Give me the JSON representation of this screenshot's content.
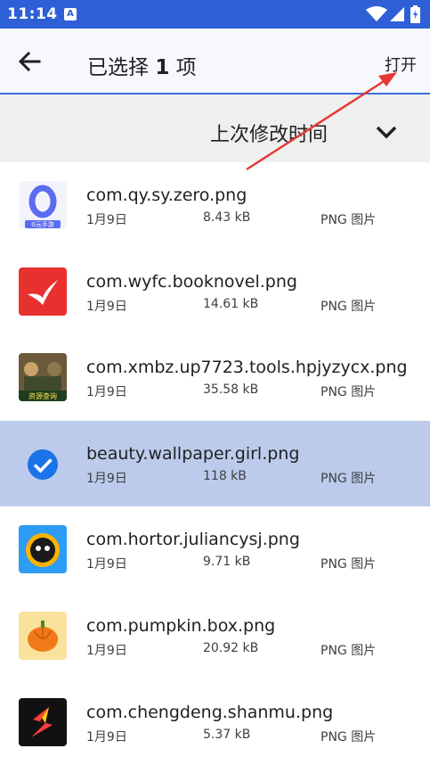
{
  "status_bar": {
    "time": "11:14",
    "notification_glyph": "A"
  },
  "app_bar": {
    "back_icon": "arrow-back-icon",
    "title_prefix": "已选择",
    "title_count": "1",
    "title_suffix": "项",
    "open_label": "打开"
  },
  "sort_bar": {
    "label": "上次修改时间",
    "toggle_icon": "chevron-down-icon"
  },
  "files": [
    {
      "name": "com.qy.sy.zero.png",
      "date": "1月9日",
      "size": "8.43 kB",
      "type": "PNG 图片",
      "icon_text": "0元手游",
      "selected": false
    },
    {
      "name": "com.wyfc.booknovel.png",
      "date": "1月9日",
      "size": "14.61 kB",
      "type": "PNG 图片",
      "selected": false
    },
    {
      "name": "com.xmbz.up7723.tools.hpjyzycx.png",
      "date": "1月9日",
      "size": "35.58 kB",
      "type": "PNG 图片",
      "icon_text": "资源查询",
      "selected": false
    },
    {
      "name": "beauty.wallpaper.girl.png",
      "date": "1月9日",
      "size": "118 kB",
      "type": "PNG 图片",
      "selected": true
    },
    {
      "name": "com.hortor.juliancysj.png",
      "date": "1月9日",
      "size": "9.71 kB",
      "type": "PNG 图片",
      "selected": false
    },
    {
      "name": "com.pumpkin.box.png",
      "date": "1月9日",
      "size": "20.92 kB",
      "type": "PNG 图片",
      "selected": false
    },
    {
      "name": "com.chengdeng.shanmu.png",
      "date": "1月9日",
      "size": "5.37 kB",
      "type": "PNG 图片",
      "selected": false
    }
  ],
  "colors": {
    "status_bar": "#2e5fd6",
    "selected_row": "#bccbeb",
    "accent": "#1a73e8",
    "annotation": "#e53935"
  }
}
